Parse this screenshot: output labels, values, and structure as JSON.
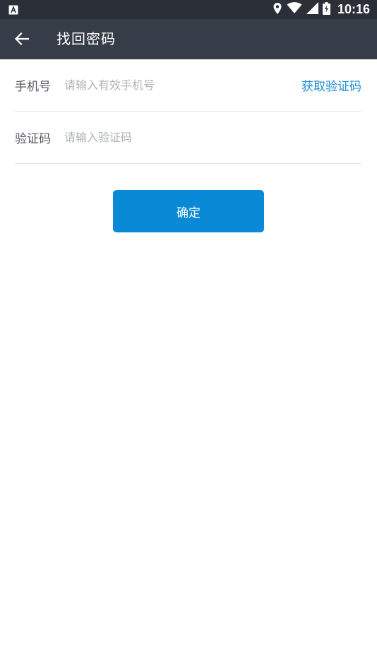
{
  "status_bar": {
    "time": "10:16",
    "icons": [
      "app-notification-icon",
      "location-icon",
      "wifi-icon",
      "signal-icon",
      "battery-icon"
    ]
  },
  "toolbar": {
    "title": "找回密码",
    "back_icon": "arrow-left-icon"
  },
  "form": {
    "phone": {
      "label": "手机号",
      "placeholder": "请输入有效手机号",
      "value": ""
    },
    "get_code_label": "获取验证码",
    "code": {
      "label": "验证码",
      "placeholder": "请输入验证码",
      "value": ""
    }
  },
  "confirm_label": "确定",
  "colors": {
    "status_bar": "#2b2f37",
    "toolbar": "#373c49",
    "accent": "#0a8ad6",
    "link": "#1b8ed3"
  }
}
